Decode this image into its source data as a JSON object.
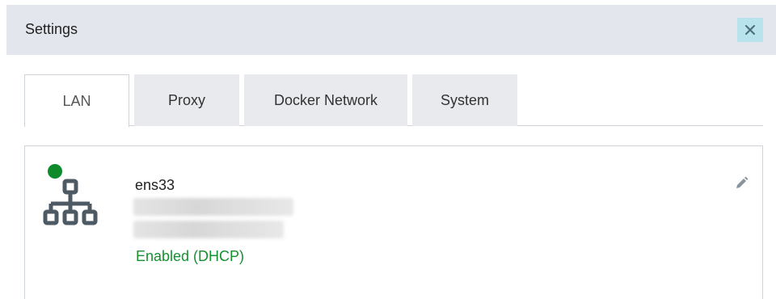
{
  "dialog": {
    "title": "Settings",
    "close_icon": "close-icon"
  },
  "tabs": [
    {
      "label": "LAN",
      "active": true
    },
    {
      "label": "Proxy",
      "active": false
    },
    {
      "label": "Docker Network",
      "active": false
    },
    {
      "label": "System",
      "active": false
    }
  ],
  "interface": {
    "name": "ens33",
    "status": "Enabled (DHCP)",
    "status_color": "#13922f",
    "indicator_color": "#0f8a2a",
    "icon": "network-topology-icon",
    "edit_icon": "pencil-icon"
  }
}
